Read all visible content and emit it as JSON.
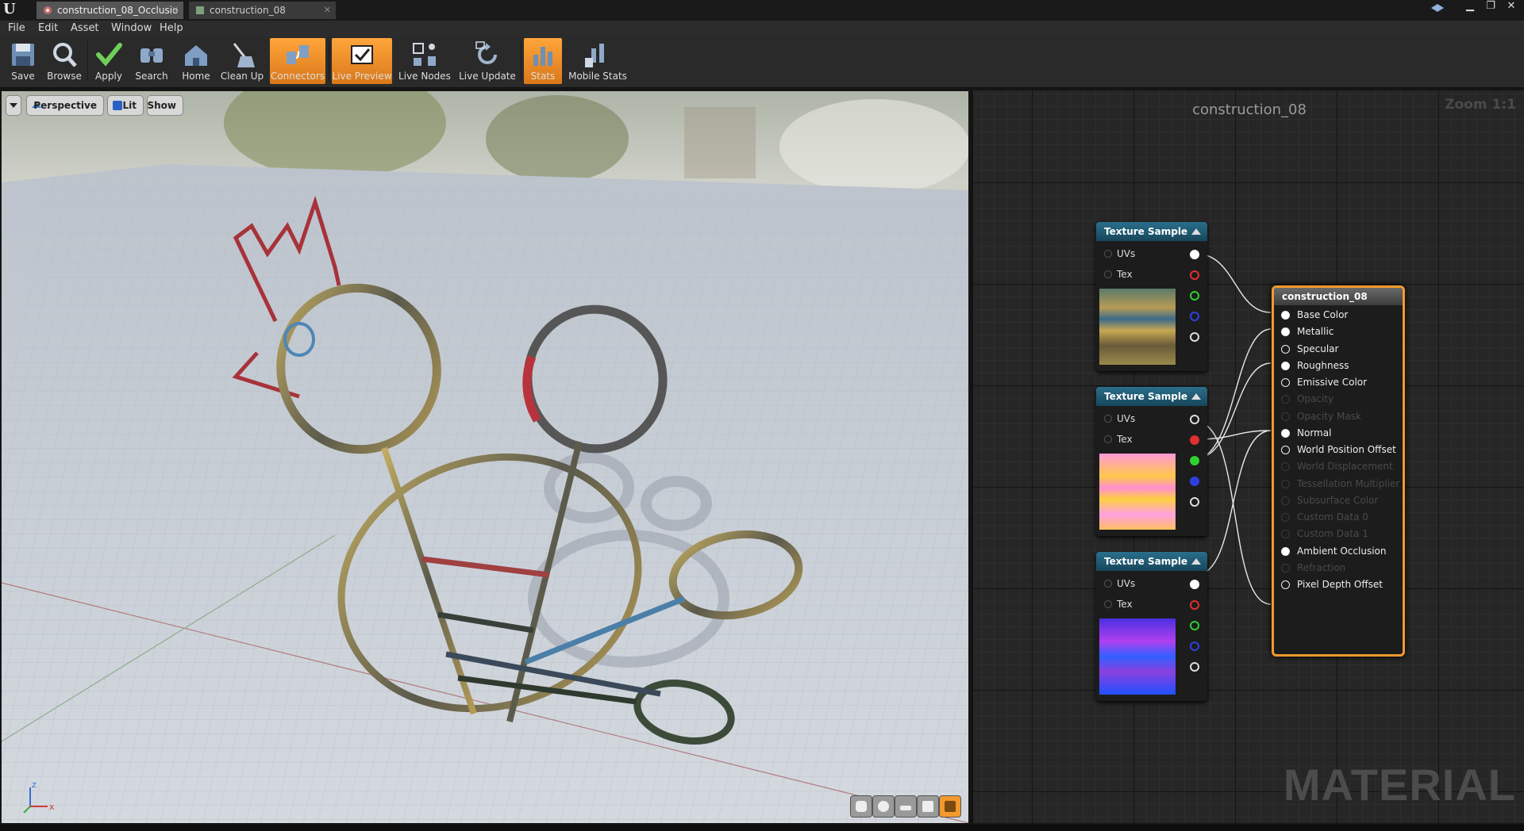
{
  "window": {
    "tabs": [
      {
        "label": "construction_08_Occlusio",
        "active": true
      },
      {
        "label": "construction_08",
        "active": false
      }
    ],
    "controls": {
      "minimize": "▁",
      "restore": "❐",
      "close": "✕"
    }
  },
  "menu": [
    "File",
    "Edit",
    "Asset",
    "Window",
    "Help"
  ],
  "toolbar": [
    {
      "label": "Save",
      "icon": "save-icon",
      "active": false
    },
    {
      "label": "Browse",
      "icon": "browse-icon",
      "active": false
    },
    {
      "label": "Apply",
      "icon": "apply-icon",
      "active": false
    },
    {
      "label": "Search",
      "icon": "search-icon",
      "active": false
    },
    {
      "label": "Home",
      "icon": "home-icon",
      "active": false
    },
    {
      "label": "Clean Up",
      "icon": "clean-up-icon",
      "active": false
    },
    {
      "label": "Connectors",
      "icon": "connectors-icon",
      "active": true
    },
    {
      "label": "Live Preview",
      "icon": "live-preview-icon",
      "active": true
    },
    {
      "label": "Live Nodes",
      "icon": "live-nodes-icon",
      "active": false
    },
    {
      "label": "Live Update",
      "icon": "live-update-icon",
      "active": false
    },
    {
      "label": "Stats",
      "icon": "stats-icon",
      "active": true
    },
    {
      "label": "Mobile Stats",
      "icon": "mobile-stats-icon",
      "active": false
    }
  ],
  "viewport": {
    "perspective_label": "Perspective",
    "lit_label": "Lit",
    "show_label": "Show",
    "axis": {
      "z": "z",
      "x": "x"
    }
  },
  "graph": {
    "title": "construction_08",
    "zoom": "Zoom 1:1",
    "watermark": "MATERIAL",
    "texture_nodes": [
      {
        "title": "Texture Sample",
        "inputs": [
          "UVs",
          "Tex"
        ],
        "thumbnail": "diffuse"
      },
      {
        "title": "Texture Sample",
        "inputs": [
          "UVs",
          "Tex"
        ],
        "thumbnail": "packed"
      },
      {
        "title": "Texture Sample",
        "inputs": [
          "UVs",
          "Tex"
        ],
        "thumbnail": "normal"
      }
    ],
    "material_node": {
      "title": "construction_08",
      "pins": [
        {
          "label": "Base Color",
          "enabled": true,
          "connected": true
        },
        {
          "label": "Metallic",
          "enabled": true,
          "connected": true
        },
        {
          "label": "Specular",
          "enabled": true,
          "connected": false
        },
        {
          "label": "Roughness",
          "enabled": true,
          "connected": true
        },
        {
          "label": "Emissive Color",
          "enabled": true,
          "connected": false
        },
        {
          "label": "Opacity",
          "enabled": false,
          "connected": false
        },
        {
          "label": "Opacity Mask",
          "enabled": false,
          "connected": false
        },
        {
          "label": "Normal",
          "enabled": true,
          "connected": true
        },
        {
          "label": "World Position Offset",
          "enabled": true,
          "connected": false
        },
        {
          "label": "World Displacement",
          "enabled": false,
          "connected": false
        },
        {
          "label": "Tessellation Multiplier",
          "enabled": false,
          "connected": false
        },
        {
          "label": "Subsurface Color",
          "enabled": false,
          "connected": false
        },
        {
          "label": "Custom Data 0",
          "enabled": false,
          "connected": false
        },
        {
          "label": "Custom Data 1",
          "enabled": false,
          "connected": false
        },
        {
          "label": "Ambient Occlusion",
          "enabled": true,
          "connected": true
        },
        {
          "label": "Refraction",
          "enabled": false,
          "connected": false
        },
        {
          "label": "Pixel Depth Offset",
          "enabled": true,
          "connected": false
        }
      ]
    }
  },
  "colors": {
    "accent": "#f39a2e",
    "node_header": "#1f5a73"
  }
}
